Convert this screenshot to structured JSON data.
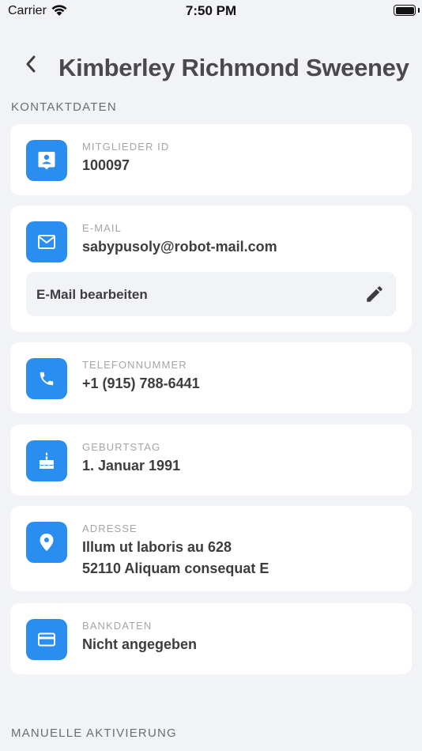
{
  "status_bar": {
    "carrier": "Carrier",
    "time": "7:50 PM"
  },
  "header": {
    "title": "Kimberley Richmond Sweeney"
  },
  "sections": {
    "contact": "KONTAKTDATEN",
    "manual": "MANUELLE AKTIVIERUNG"
  },
  "member_id": {
    "label": "MITGLIEDER ID",
    "value": "100097",
    "icon": "id-card-icon"
  },
  "email": {
    "label": "E-MAIL",
    "value": "sabypusoly@robot-mail.com",
    "edit_label": "E-Mail bearbeiten",
    "icon": "mail-icon"
  },
  "phone": {
    "label": "TELEFONNUMMER",
    "value": "+1 (915) 788-6441",
    "icon": "phone-icon"
  },
  "birthday": {
    "label": "GEBURTSTAG",
    "value": "1. Januar 1991",
    "icon": "cake-icon"
  },
  "address": {
    "label": "ADRESSE",
    "line1": "Illum ut laboris au 628",
    "line2": "52110 Aliquam consequat E",
    "icon": "location-pin-icon"
  },
  "bank": {
    "label": "BANKDATEN",
    "value": "Nicht angegeben",
    "icon": "credit-card-icon"
  },
  "colors": {
    "accent": "#2a8ef0",
    "background": "#f2f3f7",
    "card": "#ffffff"
  }
}
